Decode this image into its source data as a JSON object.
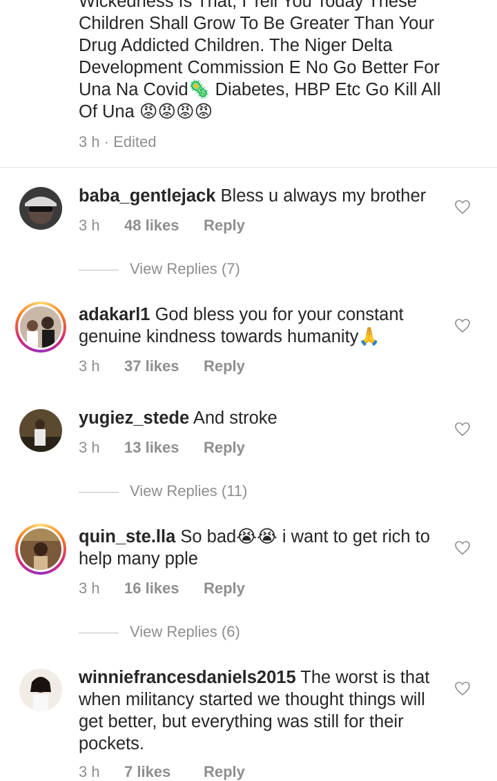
{
  "post": {
    "caption_lines": [
      "Wickedness Is That, I Tell You Today These",
      "Children Shall Grow To Be Greater Than Your",
      "Drug Addicted Children. The Niger Delta",
      "Development Commission E No Go Better For",
      "Una Na Covid🦠 Diabetes, HBP Etc Go Kill All",
      "Of Una 😡😡😡😡"
    ],
    "meta": "3 h · Edited"
  },
  "comments": [
    {
      "username": "baba_gentlejack",
      "text": "Bless u always my brother",
      "time": "3 h",
      "likes": "48 likes",
      "reply": "Reply",
      "view_replies": "View Replies (7)"
    },
    {
      "username": "adakarl1",
      "text": "God bless you for your constant genuine kindness towards humanity🙏",
      "time": "3 h",
      "likes": "37 likes",
      "reply": "Reply"
    },
    {
      "username": "yugiez_stede",
      "text": "And stroke",
      "time": "3 h",
      "likes": "13 likes",
      "reply": "Reply",
      "view_replies": "View Replies (11)"
    },
    {
      "username": "quin_ste.lla",
      "text": "So bad😭😭 i want to get rich to help many pple",
      "time": "3 h",
      "likes": "16 likes",
      "reply": "Reply",
      "view_replies": "View Replies (6)"
    },
    {
      "username": "winniefrancesdaniels2015",
      "text": "The worst is that when militancy started we thought things will get better, but everything was still for their pockets.",
      "time": "3 h",
      "likes": "7 likes",
      "reply": "Reply"
    }
  ],
  "icons": {
    "heart": "heart-outline-icon",
    "avatar_ring_colors": [
      "#feda75",
      "#fa7e1e",
      "#d62976",
      "#962fbf"
    ]
  },
  "colors": {
    "text": "#262626",
    "secondary": "#8e8e8e",
    "divider": "#e6e6e6"
  }
}
